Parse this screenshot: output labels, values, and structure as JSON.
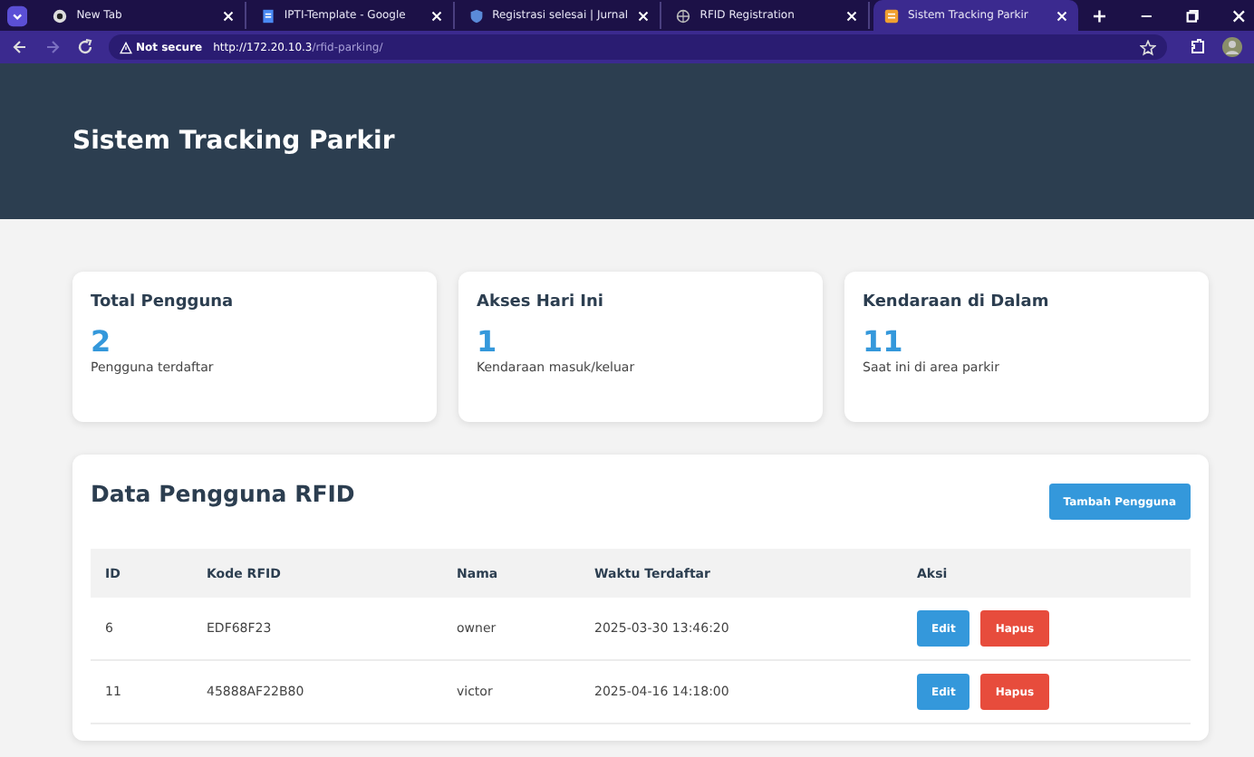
{
  "browser": {
    "tabs": [
      {
        "title": "New Tab",
        "selected": false,
        "kind": "chrome"
      },
      {
        "title": "IPTI-Template - Google",
        "selected": false,
        "kind": "doc"
      },
      {
        "title": "Registrasi selesai | Jurnal",
        "selected": false,
        "kind": "shield"
      },
      {
        "title": "RFID Registration",
        "selected": false,
        "kind": "globe"
      },
      {
        "title": "Sistem Tracking Parkir",
        "selected": true,
        "kind": "page"
      }
    ],
    "security": "Not secure",
    "url_host": "http://172.20.10.3",
    "url_path": "/rfid-parking/"
  },
  "header": {
    "title": "Sistem Tracking Parkir"
  },
  "stats": [
    {
      "title": "Total Pengguna",
      "value": "2",
      "caption": "Pengguna terdaftar"
    },
    {
      "title": "Akses Hari Ini",
      "value": "1",
      "caption": "Kendaraan masuk/keluar"
    },
    {
      "title": "Kendaraan di Dalam",
      "value": "11",
      "caption": "Saat ini di area parkir"
    }
  ],
  "users": {
    "title": "Data Pengguna RFID",
    "add_button": "Tambah Pengguna",
    "columns": [
      "ID",
      "Kode RFID",
      "Nama",
      "Waktu Terdaftar",
      "Aksi"
    ],
    "rows": [
      {
        "id": "6",
        "rfid": "EDF68F23",
        "name": "owner",
        "registered": "2025-03-30 13:46:20",
        "actions": [
          "Edit",
          "Hapus"
        ]
      },
      {
        "id": "11",
        "rfid": "45888AF22B80",
        "name": "victor",
        "registered": "2025-04-16 14:18:00",
        "actions": [
          "Edit",
          "Hapus"
        ]
      }
    ]
  }
}
